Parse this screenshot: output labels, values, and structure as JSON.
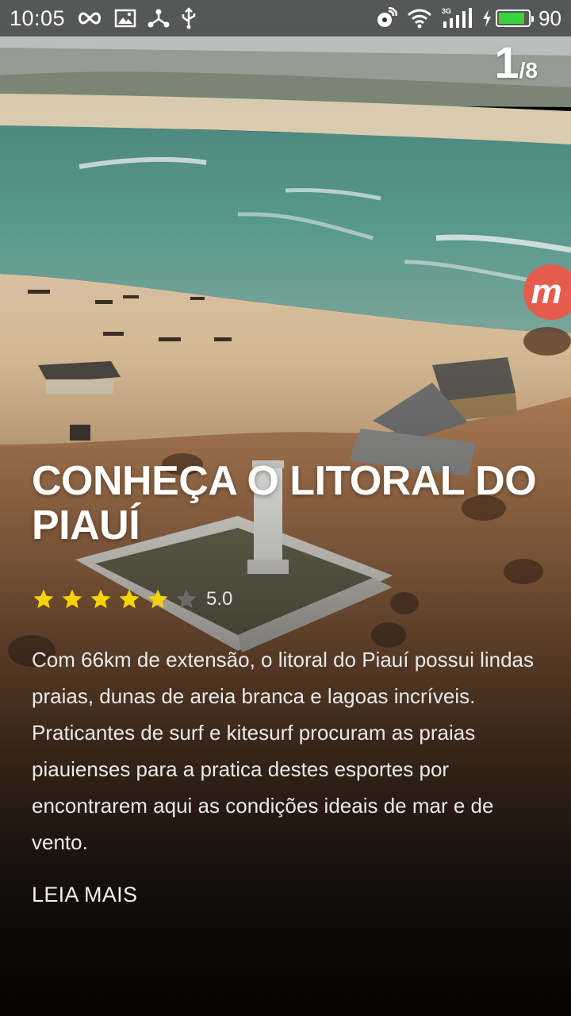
{
  "status_bar": {
    "time": "10:05",
    "battery_percent": "90",
    "battery_level": 0.9,
    "icons_left": [
      "infinity-icon",
      "image-icon",
      "share-nodes-icon",
      "usb-icon"
    ],
    "icons_right": [
      "satellite-icon",
      "wifi-icon",
      "signal-3g-icon",
      "charging-icon",
      "battery-icon"
    ]
  },
  "pager": {
    "current": "1",
    "total": "/8"
  },
  "badge": {
    "letter": "m",
    "color": "#e55c4d"
  },
  "article": {
    "title": "CONHEÇA O LITORAL DO PIAUÍ",
    "rating": {
      "value": "5.0",
      "filled_stars": 5,
      "total_stars": 6,
      "star_color": "#f6d200",
      "empty_star_color": "#6a6a6a"
    },
    "description": "Com 66km de extensão, o litoral do Piauí possui lindas praias, dunas de areia branca e lagoas incríveis. Praticantes de surf e kitesurf procuram as praias piauienses para a pratica destes esportes por encontrarem aqui as condições ideais de mar e de vento.",
    "read_more_label": "LEIA MAIS"
  }
}
